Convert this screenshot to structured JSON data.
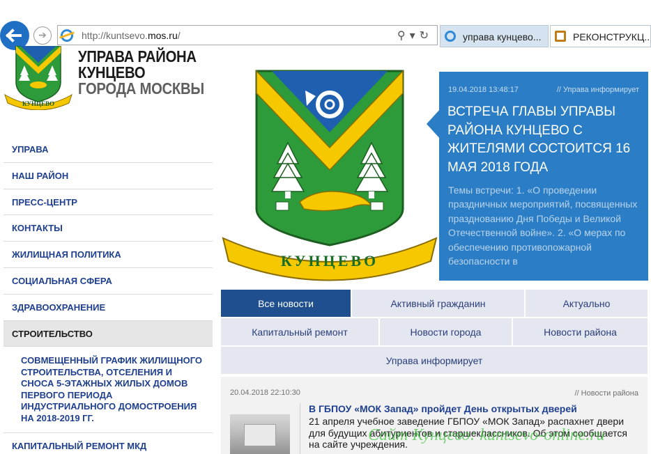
{
  "browser": {
    "url_prefix": "http://kuntsevo.",
    "url_domain": "mos.ru",
    "url_suffix": "/",
    "tabs": [
      {
        "label": "управа кунцево..."
      },
      {
        "label": "РЕКОНСТРУКЦ..."
      }
    ]
  },
  "header": {
    "title_line1": "УПРАВА РАЙОНА",
    "title_line2": "КУНЦЕВО",
    "title_line3": "ГОРОДА МОСКВЫ",
    "emblem_ribbon": "КУНЦЕВО"
  },
  "nav": {
    "items": [
      {
        "label": "УПРАВА"
      },
      {
        "label": "НАШ РАЙОН"
      },
      {
        "label": "ПРЕСС-ЦЕНТР"
      },
      {
        "label": "КОНТАКТЫ"
      },
      {
        "label": "ЖИЛИЩНАЯ ПОЛИТИКА"
      },
      {
        "label": "СОЦИАЛЬНАЯ СФЕРА"
      },
      {
        "label": "ЗДРАВООХРАНЕНИЕ"
      },
      {
        "label": "СТРОИТЕЛЬСТВО"
      }
    ],
    "sub_item": "СОВМЕЩЕННЫЙ ГРАФИК ЖИЛИЩНОГО СТРОИТЕЛЬСТВА, ОТСЕЛЕНИЯ И СНОСА 5-ЭТАЖНЫХ ЖИЛЫХ ДОМОВ ПЕРВОГО ПЕРИОДА ИНДУСТРИАЛЬНОГО ДОМОСТРОЕНИЯ НА 2018-2019 ГГ.",
    "last_item": "КАПИТАЛЬНЫЙ РЕМОНТ МКД"
  },
  "slide": {
    "date": "19.04.2018 13:48:17",
    "category": "// Управа информирует",
    "title": "ВСТРЕЧА ГЛАВЫ УПРАВЫ РАЙОНА КУНЦЕВО С ЖИТЕЛЯМИ СОСТОИТСЯ 16 МАЯ 2018 ГОДА",
    "text": "Темы встречи: 1. «О проведении праздничных мероприятий, посвященных празднованию Дня Победы и Великой Отечественной войне». 2. «О мерах по обеспечению противопожарной безопасности в"
  },
  "news_tabs": {
    "row1": [
      "Все новости",
      "Активный гражданин",
      "Актуально"
    ],
    "row2": [
      "Капитальный ремонт",
      "Новости города",
      "Новости района"
    ],
    "row3": [
      "Управа информирует"
    ]
  },
  "news_item": {
    "date": "20.04.2018 22:10:30",
    "category": "// Новости района",
    "title": "В ГБПОУ «МОК Запад» пройдет День открытых дверей",
    "text": "21 апреля учебное заведение ГБПОУ «МОК Запад» распахнет двери для будущих абитуриентов и старшеклассников. Об этом сообщается на сайте учреждения."
  },
  "watermark": "Сайт Кунцево: kuntsevo-online.ru",
  "colors": {
    "accent_blue": "#2b7ec5",
    "active_tab": "#1f4f8f",
    "nav_link": "#1f3f8f",
    "emblem_green": "#2e9b3a",
    "emblem_yellow": "#f5c800",
    "emblem_blue": "#1f5fb0"
  }
}
